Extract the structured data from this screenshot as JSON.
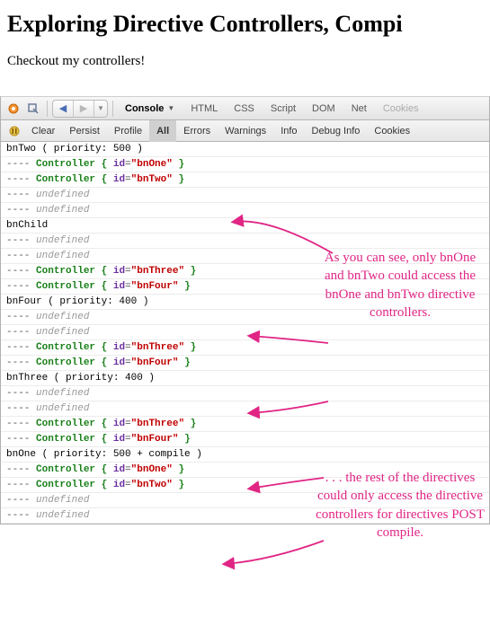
{
  "page": {
    "title": "Exploring Directive Controllers, Compi",
    "subtitle": "Checkout my controllers!"
  },
  "toolbar": {
    "tabs": {
      "console": "Console",
      "html": "HTML",
      "css": "CSS",
      "script": "Script",
      "dom": "DOM",
      "net": "Net",
      "cookies": "Cookies"
    }
  },
  "subbar": {
    "clear": "Clear",
    "persist": "Persist",
    "profile": "Profile",
    "all": "All",
    "errors": "Errors",
    "warnings": "Warnings",
    "info": "Info",
    "debug": "Debug Info",
    "cookies": "Cookies"
  },
  "lines": [
    {
      "type": "plain",
      "text": "bnTwo ( priority: 500 )"
    },
    {
      "type": "ctrl",
      "id": "bnOne"
    },
    {
      "type": "ctrl",
      "id": "bnTwo"
    },
    {
      "type": "undef"
    },
    {
      "type": "undef"
    },
    {
      "type": "plain",
      "text": "bnChild"
    },
    {
      "type": "undef"
    },
    {
      "type": "undef"
    },
    {
      "type": "ctrl",
      "id": "bnThree"
    },
    {
      "type": "ctrl",
      "id": "bnFour"
    },
    {
      "type": "plain",
      "text": "bnFour ( priority: 400 )"
    },
    {
      "type": "undef"
    },
    {
      "type": "undef"
    },
    {
      "type": "ctrl",
      "id": "bnThree"
    },
    {
      "type": "ctrl",
      "id": "bnFour"
    },
    {
      "type": "plain",
      "text": "bnThree ( priority: 400 )"
    },
    {
      "type": "undef"
    },
    {
      "type": "undef"
    },
    {
      "type": "ctrl",
      "id": "bnThree"
    },
    {
      "type": "ctrl",
      "id": "bnFour"
    },
    {
      "type": "plain",
      "text": "bnOne ( priority: 500 + compile )"
    },
    {
      "type": "ctrl",
      "id": "bnOne"
    },
    {
      "type": "ctrl",
      "id": "bnTwo"
    },
    {
      "type": "undef"
    },
    {
      "type": "undef"
    }
  ],
  "tokens": {
    "dash": "---- ",
    "controller": "Controller ",
    "open": "{ ",
    "key": "id",
    "eq": "=",
    "q": "\"",
    "close": " }",
    "undefined": "undefined"
  },
  "annotations": {
    "top": "As you can see, only bnOne and bnTwo could access the bnOne and bnTwo directive controllers.",
    "bottom": ". . . the rest of the directives could only access the directive controllers for directives POST compile."
  }
}
